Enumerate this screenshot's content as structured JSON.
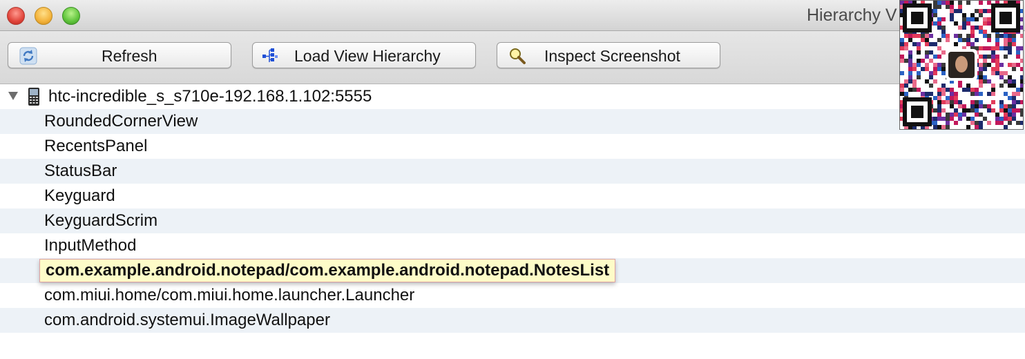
{
  "window": {
    "title": "Hierarchy V"
  },
  "toolbar": {
    "refresh_label": "Refresh",
    "load_label": "Load View Hierarchy",
    "inspect_label": "Inspect Screenshot"
  },
  "tree": {
    "device": "htc-incredible_s_s710e-192.168.1.102:5555",
    "windows": [
      "RoundedCornerView",
      "RecentsPanel",
      "StatusBar",
      "Keyguard",
      "KeyguardScrim",
      "InputMethod",
      "com.example.android.notepad/com.example.android.notepad.NotesList",
      "com.miui.home/com.miui.home.launcher.Launcher",
      "com.android.systemui.ImageWallpaper"
    ]
  },
  "colors": {
    "selection_background": "#fdfcc8",
    "selection_border": "#e0a2a2",
    "alternate_row": "#edf2f7"
  },
  "icons": {
    "refresh": "refresh-icon",
    "load": "hierarchy-tree-icon",
    "inspect": "magnifier-icon",
    "device": "phone-icon",
    "disclosure": "disclosure-triangle-icon",
    "overlay": "qr-code-icon"
  }
}
